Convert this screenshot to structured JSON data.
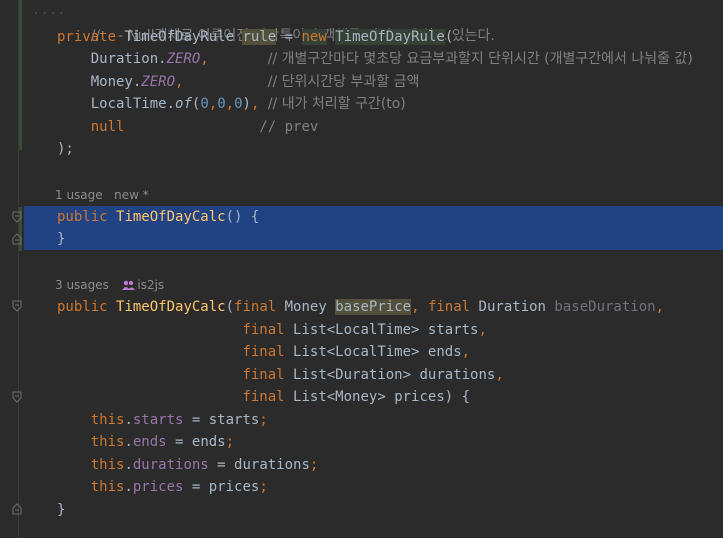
{
  "editor": {
    "line_comment_top": "//    - Null객체로 이루어진 시작특이점 객체를 미리 소유하고 있는다.",
    "decl": {
      "kw_private": "private",
      "type": "TimeOfDayRule",
      "var": "rule",
      "eq": "=",
      "kw_new": "new",
      "ctor": "TimeOfDayRule",
      "open": "("
    },
    "args": [
      {
        "cls": "Duration.",
        "const": "ZERO",
        "sep": ",",
        "pad": "       ",
        "comment": "// 개별구간마다 몇초당 요금부과할지 단위시간 (개별구간에서 나눠줄 값)"
      },
      {
        "cls": "Money.",
        "const": "ZERO",
        "sep": ",",
        "pad": "          ",
        "comment": "// 단위시간당 부과할 금액"
      },
      {
        "cls": "LocalTime.",
        "method": "of",
        "open": "(",
        "n1": "0",
        "n2": "0",
        "n3": "0",
        "close": ")",
        "sep": ",",
        "comment": "// 내가 처리할 구간(to)"
      },
      {
        "kw_null": "null",
        "pad": "                ",
        "comment": "// prev"
      }
    ],
    "close_stmt": ");",
    "hint1": {
      "usage": "1 usage",
      "new": "new *"
    },
    "ctor1": {
      "kw": "public",
      "name": "TimeOfDayCalc",
      "rest": "() {",
      "close": "}"
    },
    "hint2": {
      "usages": "3 usages",
      "author": "is2js"
    },
    "ctor2": {
      "kw": "public",
      "name": "TimeOfDayCalc",
      "open": "(",
      "params": [
        {
          "final": "final",
          "type": "Money",
          "name": "basePrice",
          "sep": ","
        },
        {
          "final": "final",
          "type": "Duration",
          "name": "baseDuration",
          "sep": ","
        },
        {
          "final": "final",
          "type": "List<LocalTime>",
          "name": "starts",
          "sep": ","
        },
        {
          "final": "final",
          "type": "List<LocalTime>",
          "name": "ends",
          "sep": ","
        },
        {
          "final": "final",
          "type": "List<Duration>",
          "name": "durations",
          "sep": ","
        },
        {
          "final": "final",
          "type": "List<Money>",
          "name": "prices",
          "sep": ") {"
        }
      ],
      "assigns": [
        {
          "this": "this",
          "field": "starts",
          "value": "starts"
        },
        {
          "this": "this",
          "field": "ends",
          "value": "ends"
        },
        {
          "this": "this",
          "field": "durations",
          "value": "durations"
        },
        {
          "this": "this",
          "field": "prices",
          "value": "prices"
        }
      ],
      "close": "}"
    },
    "colors": {
      "background": "#2b2b2b",
      "keyword": "#cc7832",
      "method": "#ffc66d",
      "field": "#9876aa",
      "number": "#6897bb",
      "comment": "#808080",
      "selection": "#214283"
    }
  }
}
